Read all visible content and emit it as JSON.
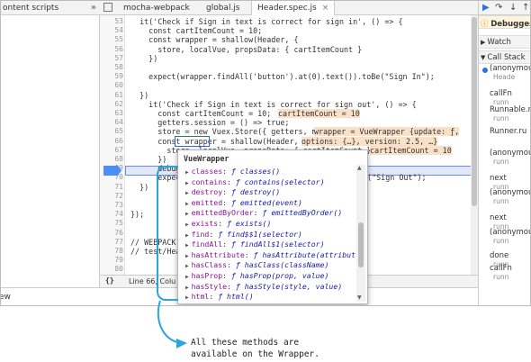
{
  "left_panel": {
    "tab_label": "ontent scripts",
    "chevron": "»",
    "bottom_tab": "ew"
  },
  "editor": {
    "tabs": [
      {
        "label": "mocha-webpack",
        "closable": false
      },
      {
        "label": "global.js",
        "closable": false
      },
      {
        "label": "Header.spec.js",
        "closable": true
      }
    ],
    "close_glyph": "×",
    "line_numbers": [
      "53",
      "54",
      "55",
      "56",
      "57",
      "58",
      "59",
      "60",
      "61",
      "62",
      "63",
      "64",
      "65",
      "66",
      "67",
      "68",
      "69",
      "70",
      "71",
      "72",
      "73",
      "74",
      "75",
      "76",
      "77",
      "78",
      "79",
      "80"
    ],
    "lines": [
      "  it('Check if Sign in text is correct for sign in', () => {",
      "    const cartItemCount = 10;",
      "    const wrapper = shallow(Header, {",
      "      store, localVue, propsData: { cartItemCount }",
      "    })",
      "",
      "    expect(wrapper.findAll('button').at(0).text()).toBe(\"Sign In\");",
      "",
      "  })",
      "    it('Check if Sign in text is correct for sign out', () => {",
      "      const cartItemCount = 10;",
      "      getters.session = () => true;",
      "      store = new Vuex.Store({ getters, m",
      "      const wrapper = shallow(Header, {",
      "        store, localVue, propsData: { cartItemCount }",
      "      })",
      "      debug",
      "      expec",
      "  })",
      "",
      "",
      "});",
      "",
      "",
      "// WEBPACK",
      "// test/Hea",
      "",
      ""
    ],
    "inline_hint_count": "cartItemCount = 10",
    "inline_hint_wrapper": "wrapper = VueWrapper {update: ƒ,",
    "inline_hint_wrapper2": "options: {…}, version: 2.5, …}",
    "inline_hint_count2": "cartItemCount = 10",
    "sign_out_tail": "e(\"Sign Out\");",
    "status_brackets": "{}",
    "status_text": "Line 66, Colu"
  },
  "debugger": {
    "title": "Debugger",
    "sections": [
      "Watch",
      "Call Stack"
    ],
    "frames": [
      {
        "name": "(anonymou",
        "sub": "Heade"
      },
      {
        "name": "callFn",
        "sub": "runn"
      },
      {
        "name": "Runnable.r",
        "sub": "runn"
      },
      {
        "name": "Runner.ru",
        "sub": ""
      },
      {
        "name": "(anonymou",
        "sub": "runn"
      },
      {
        "name": "next",
        "sub": "runn"
      },
      {
        "name": "(anonymou",
        "sub": "runn"
      },
      {
        "name": "next",
        "sub": "runn"
      },
      {
        "name": "(anonymou",
        "sub": "runn"
      },
      {
        "name": "done",
        "sub": "runn"
      },
      {
        "name": "callFn",
        "sub": "runn"
      }
    ]
  },
  "popup": {
    "title": "VueWrapper",
    "items": [
      {
        "key": "classes",
        "value": "ƒ classes()"
      },
      {
        "key": "contains",
        "value": "ƒ contains(selector)"
      },
      {
        "key": "destroy",
        "value": "ƒ destroy()"
      },
      {
        "key": "emitted",
        "value": "ƒ emitted(event)"
      },
      {
        "key": "emittedByOrder",
        "value": "ƒ emittedByOrder()"
      },
      {
        "key": "exists",
        "value": "ƒ exists()"
      },
      {
        "key": "find",
        "value": "ƒ find$$1(selector)"
      },
      {
        "key": "findAll",
        "value": "ƒ findAll$1(selector)"
      },
      {
        "key": "hasAttribute",
        "value": "ƒ hasAttribute(attribut"
      },
      {
        "key": "hasClass",
        "value": "ƒ hasClass(className)"
      },
      {
        "key": "hasProp",
        "value": "ƒ hasProp(prop, value)"
      },
      {
        "key": "hasStyle",
        "value": "ƒ hasStyle(style, value)"
      },
      {
        "key": "html",
        "value": "ƒ html()"
      }
    ]
  },
  "callout": {
    "text": "All these methods are\navailable on the Wrapper."
  },
  "colors": {
    "annotation": "#2ba4dc",
    "exec_line": "#dfe7f9",
    "hint_bg": "#fbe0c8"
  }
}
